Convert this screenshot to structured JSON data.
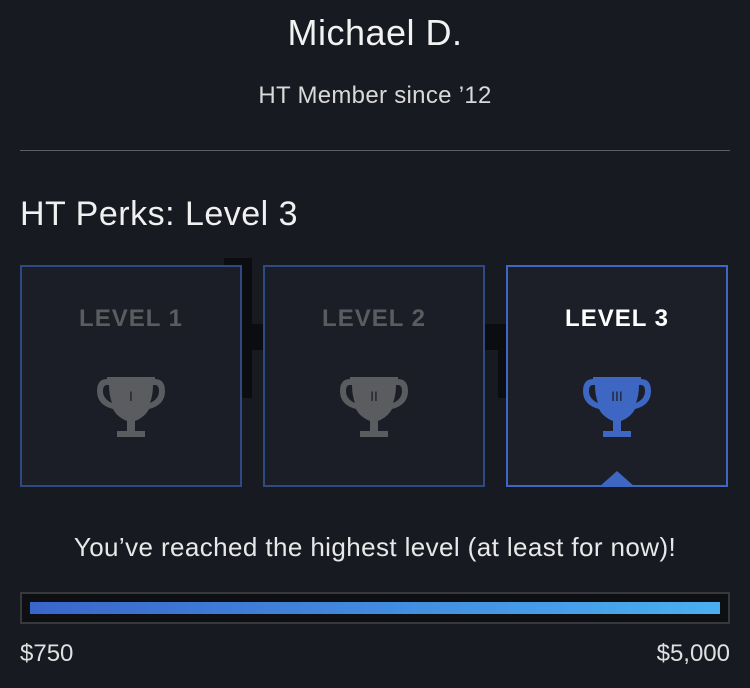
{
  "profile": {
    "name": "Michael D.",
    "member_since": "HT Member since ’12"
  },
  "perks": {
    "title": "HT Perks: Level 3",
    "levels": [
      {
        "label": "LEVEL 1",
        "numeral": "I",
        "active": false
      },
      {
        "label": "LEVEL 2",
        "numeral": "II",
        "active": false
      },
      {
        "label": "LEVEL 3",
        "numeral": "III",
        "active": true
      }
    ]
  },
  "progress": {
    "message": "You’ve reached the highest level (at least for now)!",
    "fraction": 1.0,
    "min_label": "$750",
    "max_label": "$5,000"
  },
  "colors": {
    "inactive_trophy": "#5b5c60",
    "active_trophy": "#3d67c2",
    "accent": "#3d67c2"
  }
}
